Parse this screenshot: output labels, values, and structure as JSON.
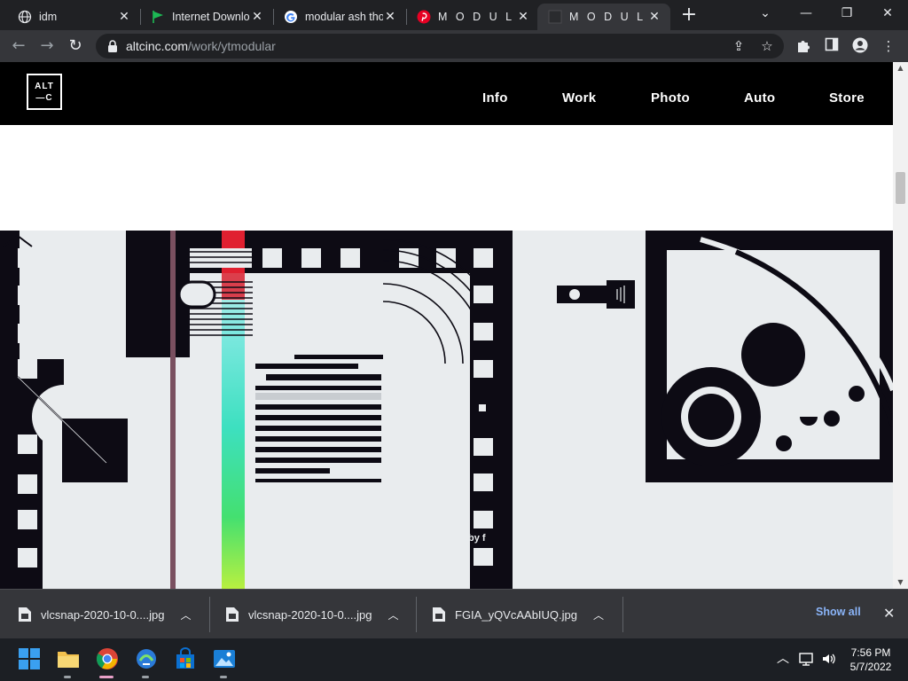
{
  "browser": {
    "tabs": [
      {
        "title": "idm",
        "favicon": "globe-icon",
        "active": false
      },
      {
        "title": "Internet Download Manager",
        "favicon": "green-flag-icon",
        "active": false
      },
      {
        "title": "modular ash thompson",
        "favicon": "google-icon",
        "active": false
      },
      {
        "title": "M O D U L A R",
        "favicon": "pinterest-icon",
        "active": false
      },
      {
        "title": "M O D U L A R",
        "favicon": "dark-square-icon",
        "active": true
      }
    ],
    "url_host": "altcinc.com",
    "url_path": "/work/ytmodular"
  },
  "site": {
    "logo_line1": "ALT",
    "logo_line2": "—C",
    "nav": [
      "Info",
      "Work",
      "Photo",
      "Auto",
      "Store"
    ],
    "hero_text": "by f"
  },
  "downloads": {
    "items": [
      {
        "name": "vlcsnap-2020-10-0....jpg"
      },
      {
        "name": "vlcsnap-2020-10-0....jpg"
      },
      {
        "name": "FGIA_yQVcAAbIUQ.jpg"
      }
    ],
    "show_all": "Show all"
  },
  "taskbar": {
    "time": "7:56 PM",
    "date": "5/7/2022"
  },
  "colors": {
    "tab_bg": "#202124",
    "toolbar_bg": "#35363a",
    "site_header": "#000000",
    "link_blue": "#8ab4f8"
  }
}
